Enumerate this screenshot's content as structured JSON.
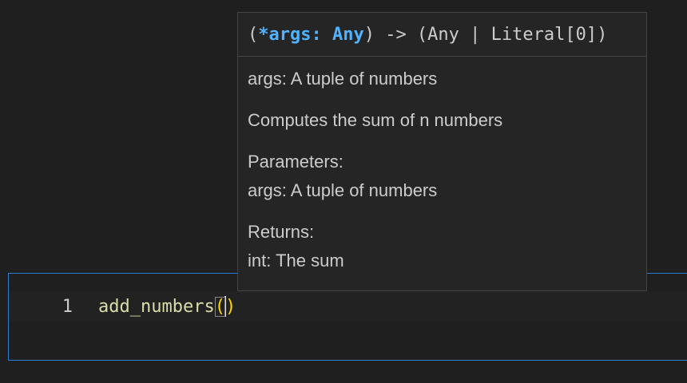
{
  "editor": {
    "line_number": "1",
    "function_name": "add_numbers",
    "open_paren": "(",
    "close_paren": ")"
  },
  "hover": {
    "signature_open": "(",
    "signature_param": "*args: Any",
    "signature_rest": ") -> (Any | Literal[0])",
    "args_line": "args: A tuple of numbers",
    "summary": "Computes the sum of n numbers",
    "parameters_heading": "Parameters:",
    "parameters_line": "args: A tuple of numbers",
    "returns_heading": "Returns:",
    "returns_line": "int: The sum"
  },
  "colors": {
    "editor_border": "#2a7bd1",
    "function_color": "#dcdcaa",
    "paren_color": "#ffd700",
    "param_color": "#4fb3ff"
  }
}
